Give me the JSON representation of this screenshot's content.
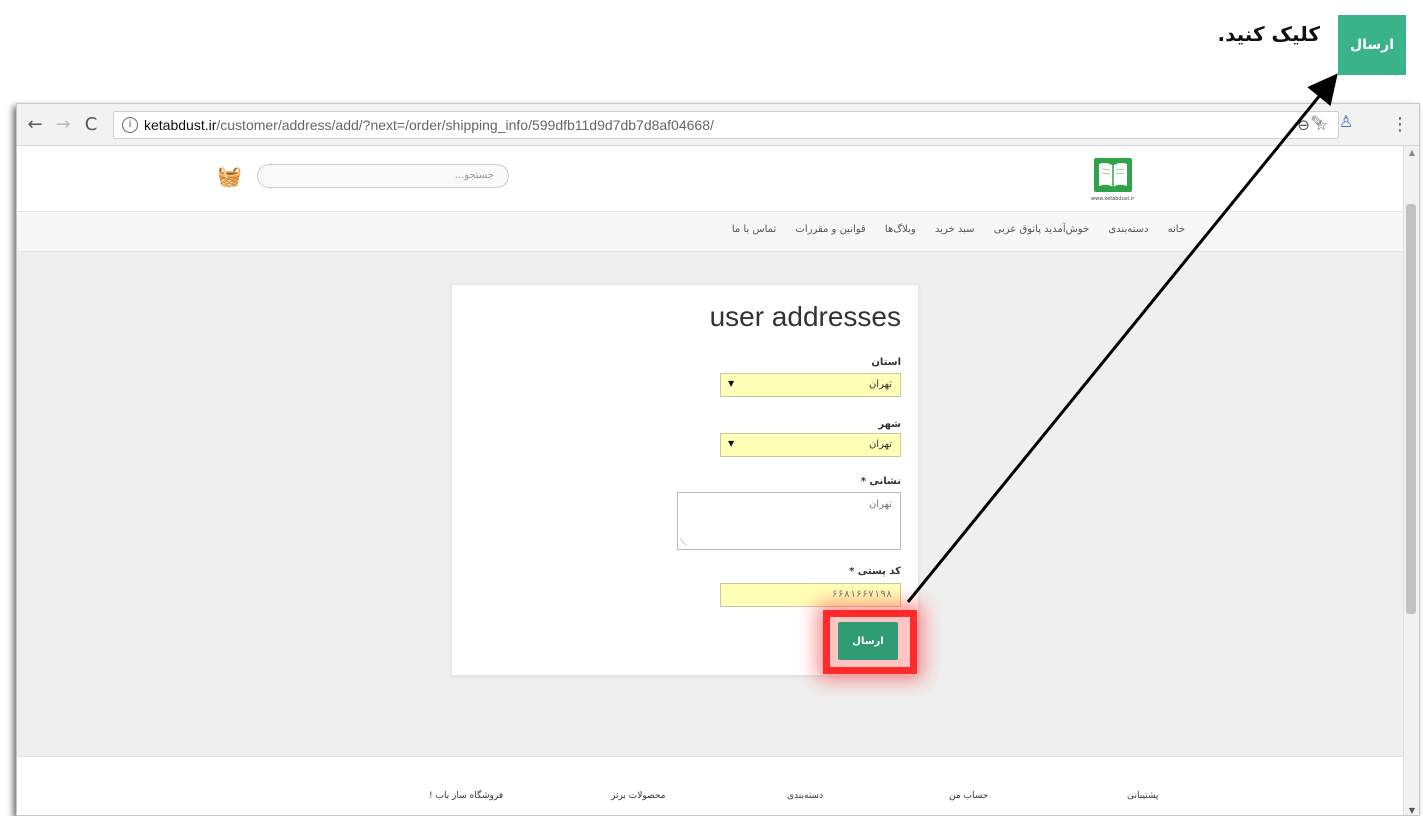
{
  "annotation": {
    "button_label": "ارسال",
    "instruction": "کلیک کنید."
  },
  "browser": {
    "url_domain": "ketabdust.ir",
    "url_path": "/customer/address/add/?next=/order/shipping_info/599dfb11d9d7db7d8af04668/",
    "icons": [
      "back-arrow-icon",
      "forward-arrow-icon",
      "reload-icon",
      "info-icon",
      "zoom-icon",
      "star-icon",
      "extension-icon",
      "profile-icon",
      "menu-icon"
    ]
  },
  "header": {
    "search_placeholder": "جستجو...",
    "logo_caption": "www.ketabdust.ir"
  },
  "nav": {
    "items": [
      "خانه",
      "دسته‌بندی",
      "خوش‌آمدید پاتوق عربی",
      "سبد خرید",
      "وبلاگ‌ها",
      "قوانین و مقررات",
      "تماس با ما"
    ]
  },
  "form": {
    "title": "user addresses",
    "province_label": "استان",
    "province_value": "تهران",
    "city_label": "شهر",
    "city_value": "تهران",
    "address_label": "نشانی *",
    "address_value": "تهران",
    "postal_label": "کد پستی *",
    "postal_value": "۶۶۸۱۶۶۷۱۹۸",
    "submit_label": "ارسال"
  },
  "footer": {
    "columns": [
      "پشتیبانی",
      "حساب من",
      "دسته‌بندی",
      "محصولات برتر",
      "فروشگاه ساز باب !"
    ]
  },
  "colors": {
    "accent_green": "#2f9c75",
    "annotation_green": "#3ab38a",
    "highlight_red": "#ff2a2a",
    "input_yellow": "#ffffb8"
  }
}
